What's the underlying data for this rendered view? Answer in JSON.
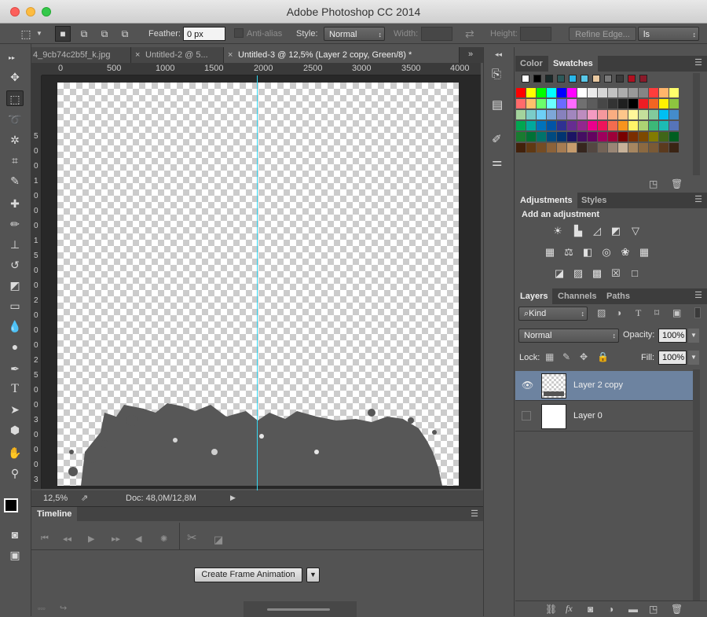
{
  "app": {
    "title": "Adobe Photoshop CC 2014"
  },
  "options_bar": {
    "feather_label": "Feather:",
    "feather_value": "0 px",
    "antialias_label": "Anti-alias",
    "style_label": "Style:",
    "style_value": "Normal",
    "width_label": "Width:",
    "height_label": "Height:",
    "refine_edge": "Refine Edge...",
    "workspace_value": "ls"
  },
  "tabs": [
    {
      "label": "4_9cb74c2b5f_k.jpg",
      "active": false
    },
    {
      "label": "Untitled-2 @ 5...",
      "active": false
    },
    {
      "label": "Untitled-3 @ 12,5% (Layer 2 copy, Green/8) *",
      "active": true
    }
  ],
  "ruler_top": [
    "0",
    "500",
    "1000",
    "1500",
    "2000",
    "2500",
    "3000",
    "3500",
    "4000"
  ],
  "ruler_left": [
    "5",
    "0",
    "0",
    "1",
    "0",
    "0",
    "0",
    "1",
    "5",
    "0",
    "0",
    "2",
    "0",
    "0",
    "0",
    "2",
    "5",
    "0",
    "0",
    "3",
    "0",
    "0",
    "0",
    "3",
    "5",
    "0",
    "0",
    "4"
  ],
  "status": {
    "zoom": "12,5%",
    "doc": "Doc: 48,0M/12,8M"
  },
  "timeline": {
    "title": "Timeline",
    "create_button": "Create Frame Animation"
  },
  "swatches_panel": {
    "tabs": [
      "Color",
      "Swatches"
    ],
    "active_tab": "Swatches",
    "recent": [
      "#ffffff",
      "#000000",
      "#1a2a2a",
      "#2d5a5a",
      "#29b6e8",
      "#58c8e8",
      "#e8c8a0",
      "#7a7a7a",
      "#3a3a3a",
      "#b01020",
      "#8a1a2a"
    ],
    "grid": [
      [
        "#ff0000",
        "#ffff00",
        "#00ff00",
        "#00ffff",
        "#0000ff",
        "#ff00ff",
        "#ffffff",
        "#ebebeb",
        "#d6d6d6",
        "#c2c2c2",
        "#adadad",
        "#999999",
        "#858585",
        "#ff3c3c",
        "#ffb56b",
        "#ffff6b"
      ],
      [
        "#ff6b6b",
        "#ffc06b",
        "#6bff6b",
        "#6bffff",
        "#6b6bff",
        "#ff6bff",
        "#707070",
        "#5c5c5c",
        "#474747",
        "#333333",
        "#1f1f1f",
        "#000000",
        "#ee1d24",
        "#f26522",
        "#fff200",
        "#8dc63f"
      ],
      [
        "#a3d39c",
        "#7accc8",
        "#6dcff6",
        "#7da7d8",
        "#8781bd",
        "#a186be",
        "#bd8cbf",
        "#f49ac1",
        "#f5989d",
        "#f9ad81",
        "#fdc68a",
        "#fff79a",
        "#c4df9b",
        "#82ca9c",
        "#00bff3",
        "#448ccb"
      ],
      [
        "#00a651",
        "#00a99d",
        "#0072bc",
        "#0054a6",
        "#2e3192",
        "#662d91",
        "#92278f",
        "#ec008c",
        "#ed145b",
        "#f26c4f",
        "#f7941d",
        "#fff568",
        "#acd373",
        "#3cb878",
        "#1cbbb4",
        "#5674b9"
      ],
      [
        "#197b30",
        "#007236",
        "#00746b",
        "#004a80",
        "#003471",
        "#1b1464",
        "#440e62",
        "#630460",
        "#9e005d",
        "#9e0039",
        "#790000",
        "#7b2e00",
        "#7d4900",
        "#827b00",
        "#406618",
        "#005e20"
      ],
      [
        "#42210b",
        "#603913",
        "#754c24",
        "#8c6239",
        "#a67c52",
        "#c69c6d",
        "#36261e",
        "#534741",
        "#736357",
        "#998675",
        "#c7b299",
        "#a68660",
        "#8b6941",
        "#7a5a36",
        "#5b3a1e",
        "#3a2414"
      ]
    ]
  },
  "adjustments_panel": {
    "tabs": [
      "Adjustments",
      "Styles"
    ],
    "heading": "Add an adjustment"
  },
  "layers_panel": {
    "tabs": [
      "Layers",
      "Channels",
      "Paths"
    ],
    "filter_value": "Kind",
    "blend_mode": "Normal",
    "opacity_label": "Opacity:",
    "opacity_value": "100%",
    "lock_label": "Lock:",
    "fill_label": "Fill:",
    "fill_value": "100%",
    "layers": [
      {
        "name": "Layer 2 copy",
        "visible": true,
        "selected": true
      },
      {
        "name": "Layer 0",
        "visible": false,
        "selected": false
      }
    ]
  },
  "icons": {
    "eye": "eye-icon",
    "fx": "fx"
  }
}
